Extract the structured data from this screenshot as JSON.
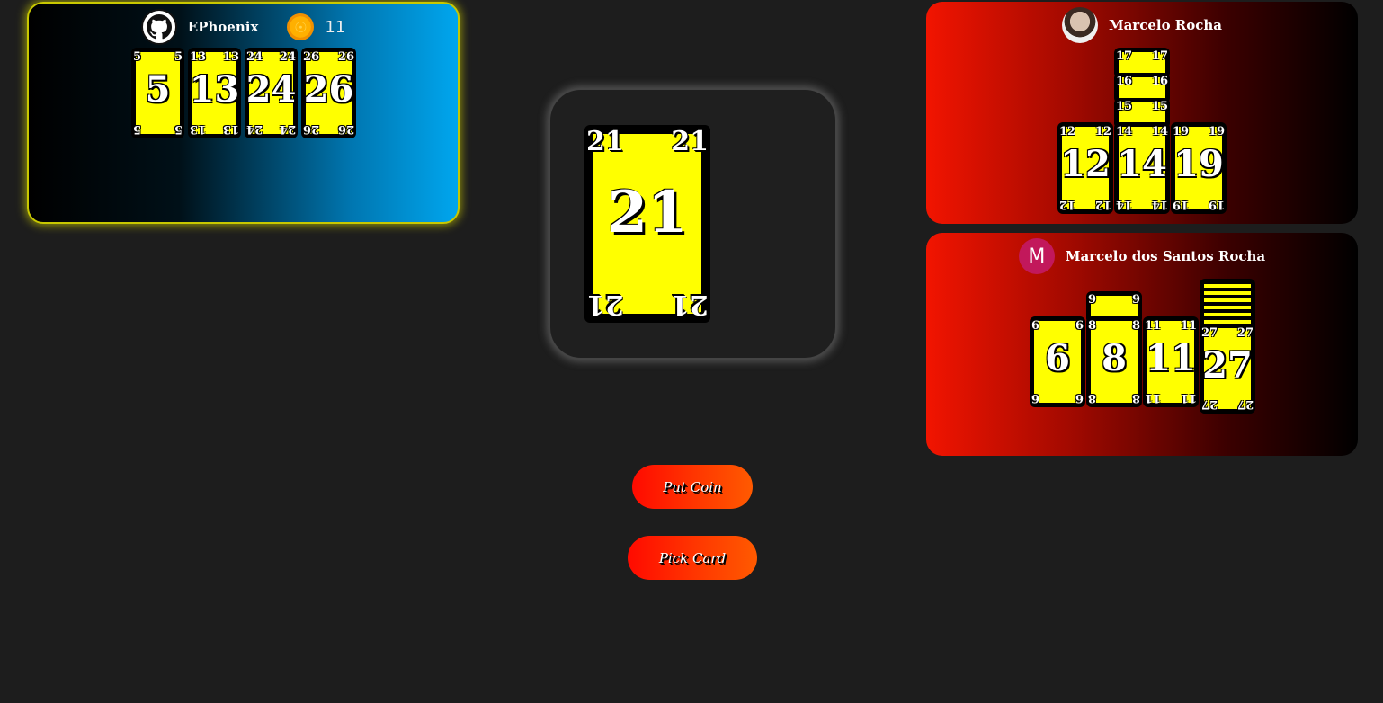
{
  "me": {
    "name": "EPhoenix",
    "coins": "11",
    "cards": [
      "5",
      "13",
      "24",
      "26"
    ]
  },
  "opponent1": {
    "name": "Marcelo Rocha",
    "stack_top": [
      "17",
      "16",
      "15"
    ],
    "cards": [
      "12",
      "14",
      "19"
    ]
  },
  "opponent2": {
    "name": "Marcelo dos Santos Rocha",
    "avatar_letter": "M",
    "cards": [
      "6",
      "8",
      "11",
      "27"
    ],
    "stack_above_8": "9"
  },
  "center": {
    "card": "21"
  },
  "actions": {
    "put_coin": "Put Coin",
    "pick_card": "Pick Card"
  },
  "colors": {
    "card_face": "#ffff00",
    "card_border": "#000000",
    "button": "#ff2a00",
    "active_glow": "#c8c800"
  }
}
